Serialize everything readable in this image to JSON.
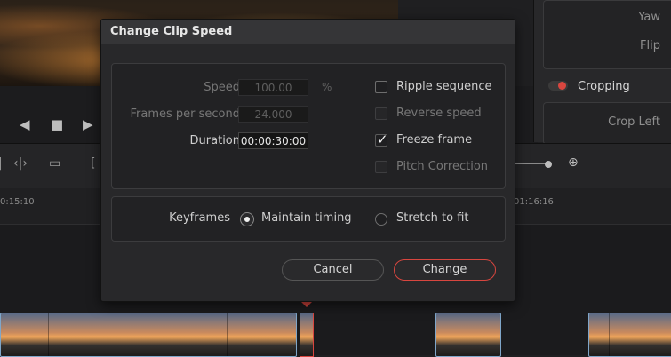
{
  "background": {
    "inspector": {
      "yaw_label": "Yaw",
      "flip_label": "Flip",
      "cropping_label": "Cropping",
      "crop_left_label": "Crop Left"
    },
    "ruler": {
      "left_timecode": "0:15:10",
      "right_timecode": "01:16:16"
    }
  },
  "dialog": {
    "title": "Change Clip Speed",
    "speed": {
      "label": "Speed",
      "value": "100.00",
      "unit": "%"
    },
    "fps": {
      "label": "Frames per second",
      "value": "24.000"
    },
    "duration": {
      "label": "Duration",
      "value": "00:00:30:00"
    },
    "options": {
      "ripple": {
        "label": "Ripple sequence",
        "checked": false,
        "enabled": true
      },
      "reverse": {
        "label": "Reverse speed",
        "checked": false,
        "enabled": false
      },
      "freeze": {
        "label": "Freeze frame",
        "checked": true,
        "enabled": true
      },
      "pitch": {
        "label": "Pitch Correction",
        "checked": false,
        "enabled": false
      }
    },
    "keyframes": {
      "label": "Keyframes",
      "maintain": "Maintain timing",
      "stretch": "Stretch to fit",
      "selected": "maintain"
    },
    "buttons": {
      "cancel": "Cancel",
      "change": "Change"
    }
  },
  "colors": {
    "accent_red": "#d8463f",
    "clip_border": "#7fa6c9",
    "playhead": "#d8463f"
  }
}
